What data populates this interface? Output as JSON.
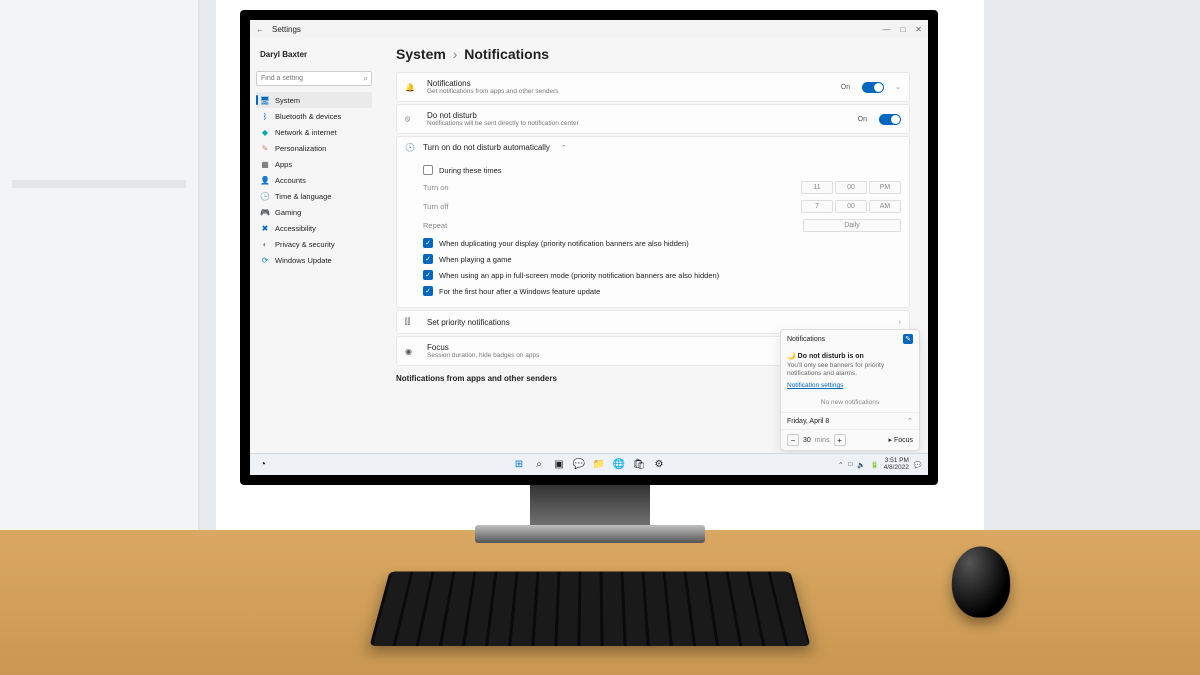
{
  "window": {
    "title": "Settings",
    "user": "Daryl Baxter",
    "back": "←",
    "min": "—",
    "max": "□",
    "close": "✕"
  },
  "search": {
    "placeholder": "Find a setting"
  },
  "sidebar": [
    {
      "icon": "🖥",
      "label": "System",
      "sel": true,
      "color": "#0067c0"
    },
    {
      "icon": "ᛒ",
      "label": "Bluetooth & devices",
      "color": "#0067c0"
    },
    {
      "icon": "◆",
      "label": "Network & internet",
      "color": "#0aa"
    },
    {
      "icon": "✎",
      "label": "Personalization",
      "color": "#c86"
    },
    {
      "icon": "▦",
      "label": "Apps",
      "color": "#555"
    },
    {
      "icon": "👤",
      "label": "Accounts",
      "color": "#2a8"
    },
    {
      "icon": "🕒",
      "label": "Time & language",
      "color": "#08a"
    },
    {
      "icon": "🎮",
      "label": "Gaming",
      "color": "#888"
    },
    {
      "icon": "✖",
      "label": "Accessibility",
      "color": "#06c"
    },
    {
      "icon": "◐",
      "label": "Privacy & security",
      "color": "#888"
    },
    {
      "icon": "⟳",
      "label": "Windows Update",
      "color": "#08c"
    }
  ],
  "breadcrumb": {
    "a": "System",
    "sep": "›",
    "b": "Notifications"
  },
  "rows": {
    "notif": {
      "title": "Notifications",
      "sub": "Get notifications from apps and other senders",
      "state": "On"
    },
    "dnd": {
      "title": "Do not disturb",
      "sub": "Notifications will be sent directly to notification center",
      "state": "On"
    },
    "auto": {
      "title": "Turn on do not disturb automatically"
    },
    "priority": {
      "title": "Set priority notifications"
    },
    "focus": {
      "title": "Focus",
      "sub": "Session duration, hide badges on apps"
    }
  },
  "auto": {
    "during": "During these times",
    "turnon": "Turn on",
    "turnoff": "Turn off",
    "repeat": "Repeat",
    "h1": "11",
    "m1": "00",
    "ap1": "PM",
    "h2": "7",
    "m2": "00",
    "ap2": "AM",
    "rep": "Daily",
    "c1": "When duplicating your display (priority notification banners are also hidden)",
    "c2": "When playing a game",
    "c3": "When using an app in full-screen mode (priority notification banners are also hidden)",
    "c4": "For the first hour after a Windows feature update"
  },
  "section2": "Notifications from apps and other senders",
  "panel": {
    "head": "Notifications",
    "title": "Do not disturb is on",
    "sub": "You'll only see banners for priority notifications and alarms.",
    "link": "Notification settings",
    "none": "No new notifications",
    "date": "Friday, April 8",
    "mins": "30",
    "minslbl": "mins",
    "focus": "Focus"
  },
  "taskbar": {
    "time": "3:51 PM",
    "date": "4/8/2022"
  }
}
